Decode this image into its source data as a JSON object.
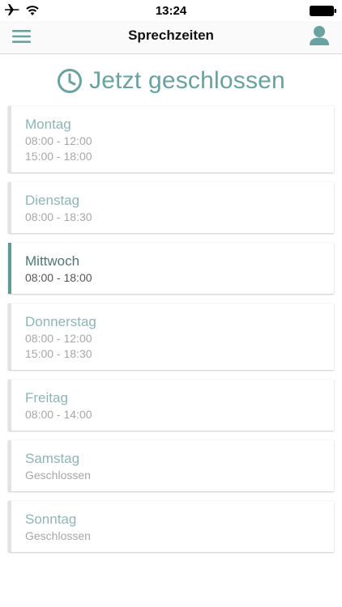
{
  "status_bar": {
    "time": "13:24",
    "icons": [
      "airplane-icon",
      "wifi-icon",
      "battery-icon"
    ]
  },
  "header": {
    "title": "Sprechzeiten",
    "menu_icon": "hamburger-icon",
    "profile_icon": "user-icon"
  },
  "status": {
    "icon": "clock-icon",
    "text": "Jetzt geschlossen"
  },
  "colors": {
    "accent": "#6aa1a1",
    "active_border": "#5f9999",
    "inactive_text": "#8fb4b4",
    "hours_text": "#a7a7a7"
  },
  "days": [
    {
      "name": "Montag",
      "hours": [
        "08:00 - 12:00",
        "15:00 - 18:00"
      ],
      "active": false
    },
    {
      "name": "Dienstag",
      "hours": [
        "08:00 - 18:30"
      ],
      "active": false
    },
    {
      "name": "Mittwoch",
      "hours": [
        "08:00 - 18:00"
      ],
      "active": true
    },
    {
      "name": "Donnerstag",
      "hours": [
        "08:00 - 12:00",
        "15:00 - 18:30"
      ],
      "active": false
    },
    {
      "name": "Freitag",
      "hours": [
        "08:00 - 14:00"
      ],
      "active": false
    },
    {
      "name": "Samstag",
      "hours": [
        "Geschlossen"
      ],
      "active": false
    },
    {
      "name": "Sonntag",
      "hours": [
        "Geschlossen"
      ],
      "active": false
    }
  ]
}
